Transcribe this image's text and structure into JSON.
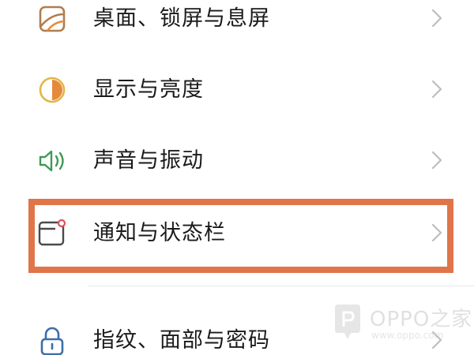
{
  "settings": {
    "items": [
      {
        "label": "桌面、锁屏与息屏",
        "icon": "wallpaper-icon"
      },
      {
        "label": "显示与亮度",
        "icon": "brightness-icon"
      },
      {
        "label": "声音与振动",
        "icon": "speaker-icon"
      },
      {
        "label": "通知与状态栏",
        "icon": "notification-icon"
      },
      {
        "label": "指纹、面部与密码",
        "icon": "lock-icon"
      }
    ]
  },
  "colors": {
    "highlight": "#e0754a",
    "wallpaper_icon": "#b07d4f",
    "brightness_icon": "#e58a3c",
    "speaker_icon": "#3f9a56",
    "notification_icon": "#4a4a4a",
    "notification_dot": "#e0505a",
    "lock_icon": "#3d6fa8",
    "chevron": "#bdbdbd"
  },
  "watermark": {
    "brand": "OPPO之家",
    "url": "www.oppo.com"
  }
}
